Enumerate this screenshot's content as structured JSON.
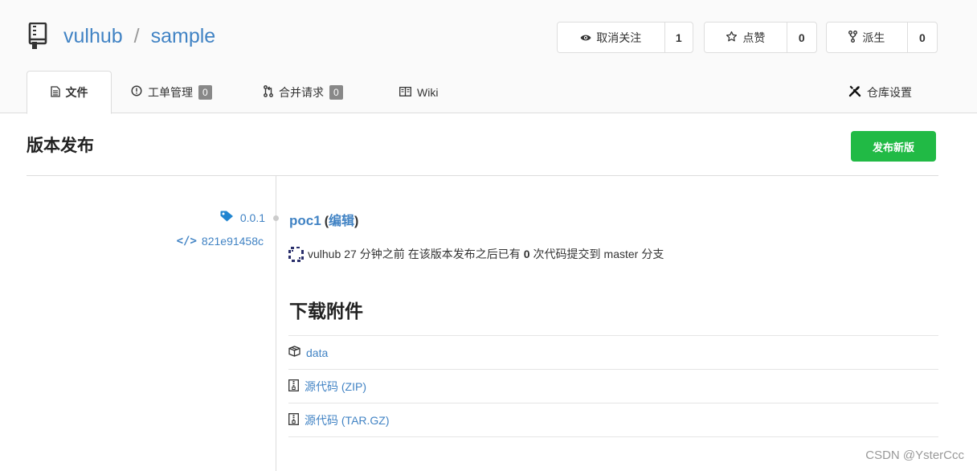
{
  "repo": {
    "owner": "vulhub",
    "separator": "/",
    "name": "sample"
  },
  "actions": {
    "watch": {
      "label": "取消关注",
      "count": "1"
    },
    "star": {
      "label": "点赞",
      "count": "0"
    },
    "fork": {
      "label": "派生",
      "count": "0"
    }
  },
  "tabs": {
    "files": {
      "label": "文件"
    },
    "issues": {
      "label": "工单管理",
      "count": "0"
    },
    "pulls": {
      "label": "合并请求",
      "count": "0"
    },
    "wiki": {
      "label": "Wiki"
    },
    "settings": {
      "label": "仓库设置"
    }
  },
  "page": {
    "title": "版本发布",
    "new_release_label": "发布新版"
  },
  "release": {
    "tag": "0.0.1",
    "commit": "821e91458c",
    "title": "poc1",
    "edit_open": "(",
    "edit_label": "编辑",
    "edit_close": ")",
    "author": "vulhub",
    "time": "27 分钟之前",
    "meta_prefix": "在该版本发布之后已有",
    "commits_count": "0",
    "meta_middle": "次代码提交到",
    "branch": "master",
    "meta_suffix": "分支"
  },
  "downloads": {
    "title": "下载附件",
    "items": [
      {
        "label": "data",
        "icon": "package-icon"
      },
      {
        "label": "源代码 (ZIP)",
        "icon": "file-zip-icon"
      },
      {
        "label": "源代码 (TAR.GZ)",
        "icon": "file-zip-icon"
      }
    ]
  },
  "watermark": "CSDN @YsterCcc",
  "colors": {
    "link": "#4183c4",
    "primary_button": "#21ba45",
    "badge": "#888888"
  }
}
